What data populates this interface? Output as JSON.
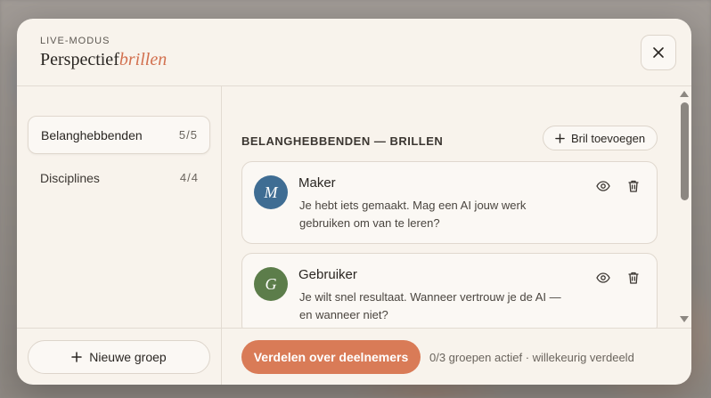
{
  "header": {
    "eyebrow": "LIVE-MODUS",
    "title_main": "Perspectief",
    "title_accent": "brillen"
  },
  "sidebar": {
    "items": [
      {
        "label": "Belanghebbenden",
        "count": "5/5",
        "active": true
      },
      {
        "label": "Disciplines",
        "count": "4/4",
        "active": false
      }
    ],
    "new_group_label": "Nieuwe groep"
  },
  "main": {
    "section_title": "BELANGHEBBENDEN — BRILLEN",
    "add_lens_label": "Bril toevoegen",
    "cards": [
      {
        "initial": "M",
        "name": "Maker",
        "description": "Je hebt iets gemaakt. Mag een AI jouw werk gebruiken om van te leren?",
        "color": "#3f6d93"
      },
      {
        "initial": "G",
        "name": "Gebruiker",
        "description": "Je wilt snel resultaat. Wanneer vertrouw je de AI — en wanneer niet?",
        "color": "#5c7d4a"
      }
    ]
  },
  "footer": {
    "distribute_label": "Verdelen over deelnemers",
    "status": "0/3 groepen actief · willekeurig verdeeld"
  },
  "colors": {
    "accent": "#d97b57",
    "panel": "#f8f3ec"
  },
  "icons": [
    "close-icon",
    "plus-icon",
    "eye-icon",
    "trash-icon"
  ]
}
